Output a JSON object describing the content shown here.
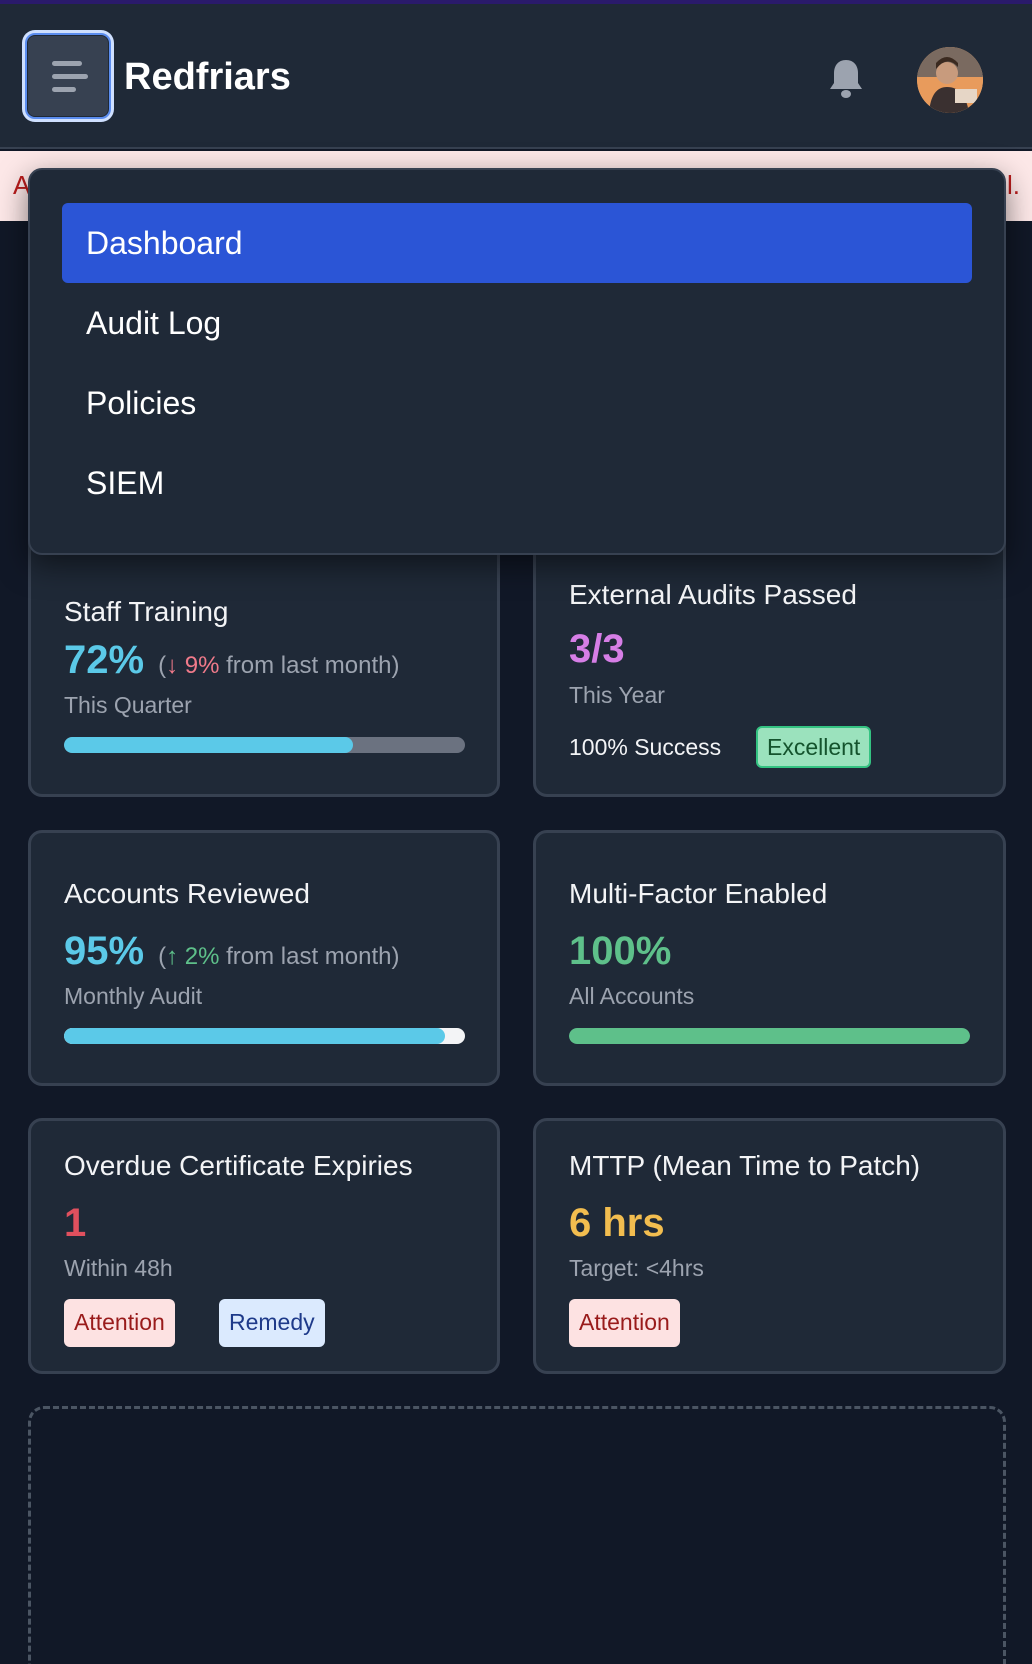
{
  "header": {
    "brand": "Redfriars",
    "menu_icon": "hamburger-icon",
    "notification_icon": "bell-icon",
    "avatar_alt": "user avatar"
  },
  "alert": {
    "left_fragment": "A",
    "right_fragment": "l."
  },
  "nav": {
    "items": [
      {
        "label": "Dashboard",
        "active": true
      },
      {
        "label": "Audit Log",
        "active": false
      },
      {
        "label": "Policies",
        "active": false
      },
      {
        "label": "SIEM",
        "active": false
      }
    ]
  },
  "cards": {
    "staff_training": {
      "title": "Staff Training",
      "value": "72%",
      "delta_open": "(",
      "delta_arrow": "↓",
      "delta_value": "9%",
      "delta_text": "from last month)",
      "sub": "This Quarter",
      "progress": 0.72,
      "bar_color": "#5bc9e8",
      "track_color": "#6b7280"
    },
    "external_audits": {
      "title": "External Audits Passed",
      "value": "3/3",
      "sub": "This Year",
      "success_text": "100% Success",
      "badge": "Excellent",
      "value_color": "#d67ee6"
    },
    "accounts_reviewed": {
      "title": "Accounts Reviewed",
      "value": "95%",
      "delta_open": "(",
      "delta_arrow": "↑",
      "delta_value": "2%",
      "delta_text": "from last month)",
      "sub": "Monthly Audit",
      "progress": 0.95,
      "bar_color": "#5bc9e8",
      "track_color": "#f3f4f6"
    },
    "mfa": {
      "title": "Multi-Factor Enabled",
      "value": "100%",
      "sub": "All Accounts",
      "progress": 1.0,
      "bar_color": "#5ec08a",
      "value_color": "#5ec08a"
    },
    "overdue_certs": {
      "title": "Overdue Certificate Expiries",
      "value": "1",
      "sub": "Within 48h",
      "tag1": "Attention",
      "tag2": "Remedy",
      "value_color": "#e0505e"
    },
    "mttp": {
      "title": "MTTP (Mean Time to Patch)",
      "value": "6 hrs",
      "sub": "Target: <4hrs",
      "tag1": "Attention",
      "value_color": "#f2bd4f"
    }
  },
  "colors": {
    "accent": "#2b55d6",
    "teal": "#5bc9e8",
    "down": "#f07a8a",
    "up": "#5ec08a"
  }
}
